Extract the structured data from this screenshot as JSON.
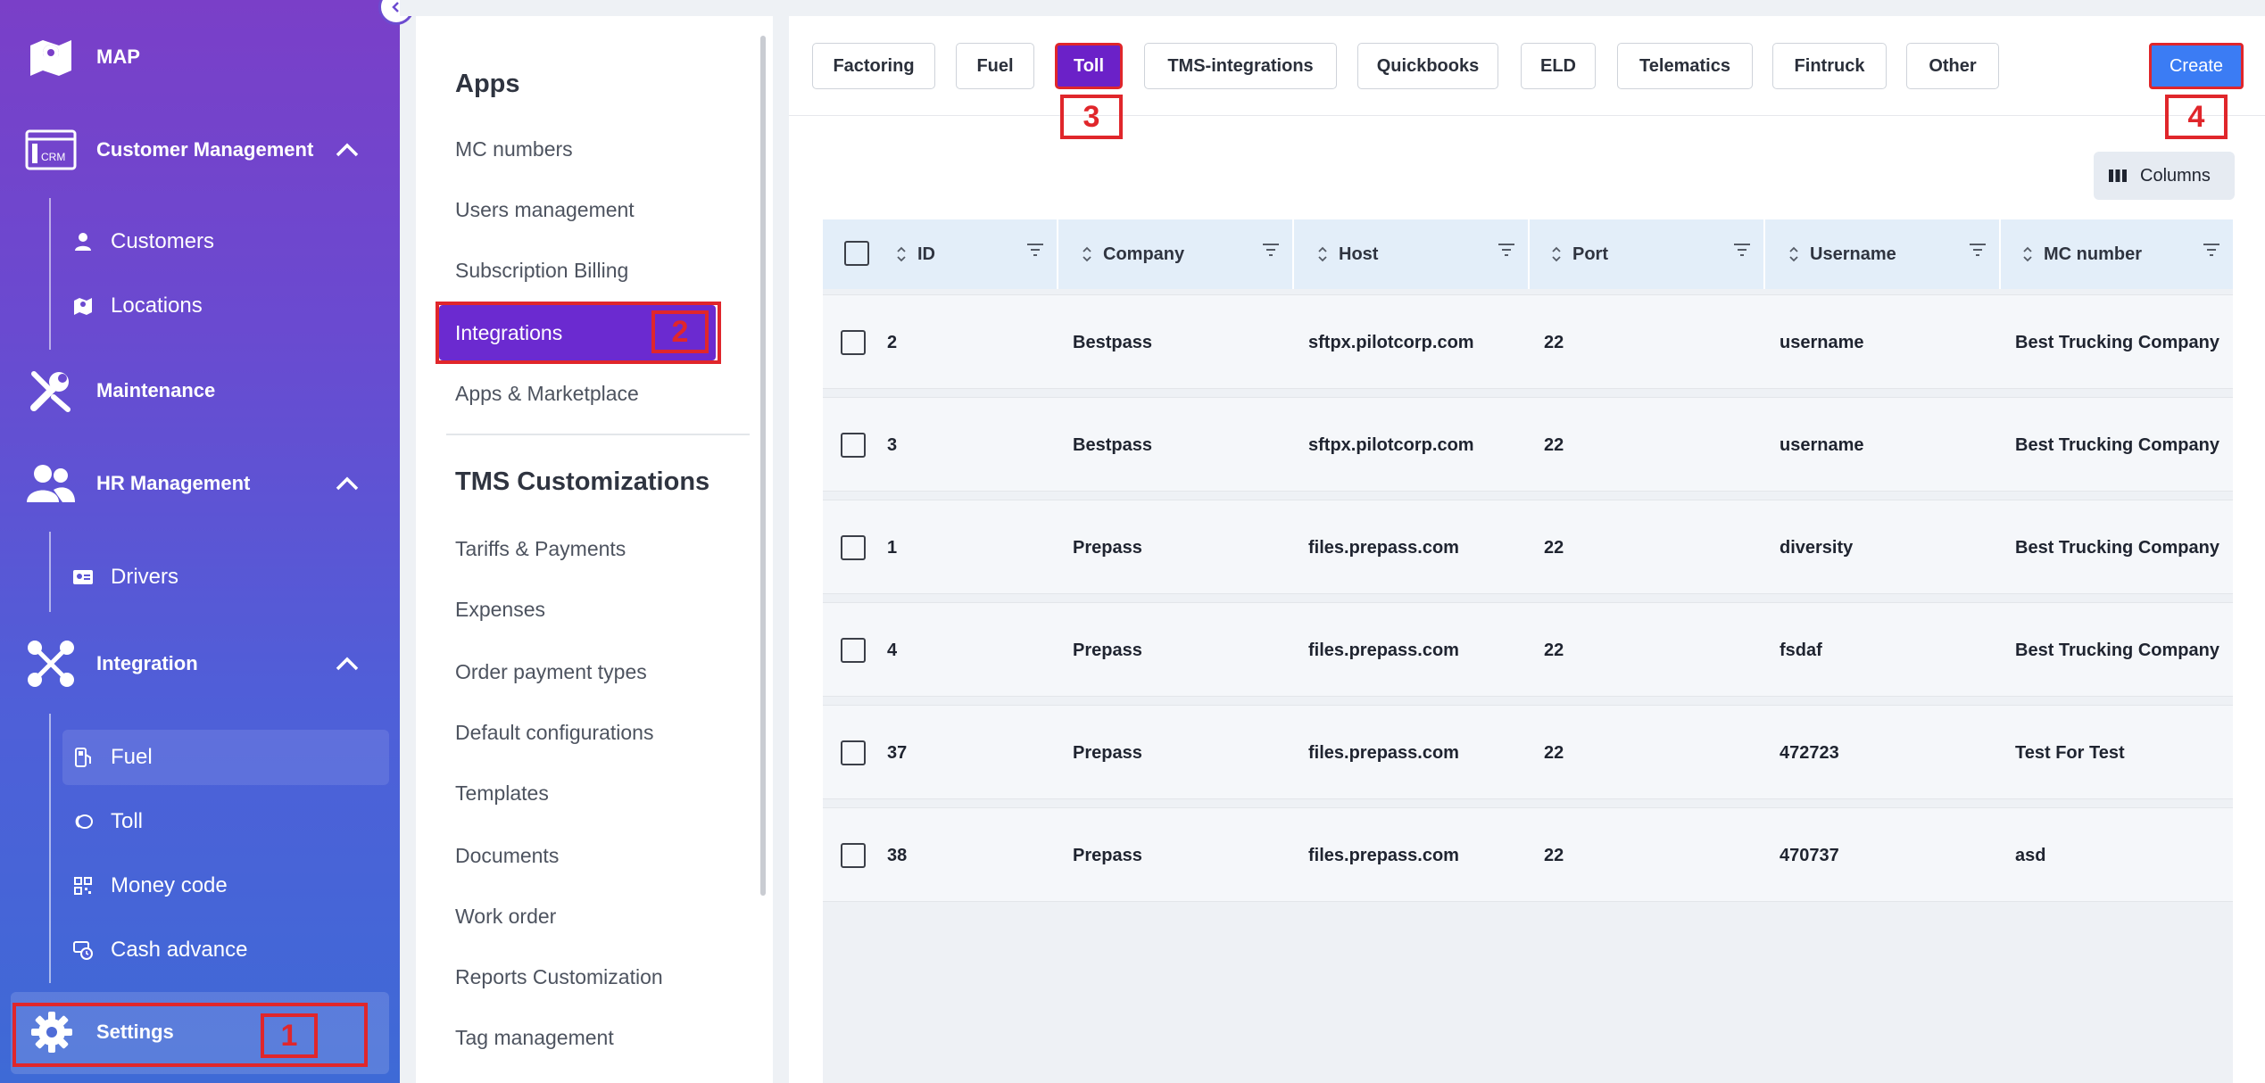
{
  "sidebar": {
    "map": "MAP",
    "customer_management": "Customer Management",
    "customers": "Customers",
    "locations": "Locations",
    "maintenance": "Maintenance",
    "hr_management": "HR Management",
    "drivers": "Drivers",
    "integration": "Integration",
    "fuel": "Fuel",
    "toll": "Toll",
    "money_code": "Money code",
    "cash_advance": "Cash advance",
    "settings": "Settings",
    "crm_badge": "CRM"
  },
  "settings_panel": {
    "apps_title": "Apps",
    "apps_items": [
      "MC numbers",
      "Users management",
      "Subscription Billing",
      "Integrations",
      "Apps & Marketplace"
    ],
    "tms_title": "TMS Customizations",
    "tms_items": [
      "Tariffs & Payments",
      "Expenses",
      "Order payment types",
      "Default configurations",
      "Templates",
      "Documents",
      "Work order",
      "Reports Customization",
      "Tag management"
    ]
  },
  "tabs": [
    "Factoring",
    "Fuel",
    "Toll",
    "TMS-integrations",
    "Quickbooks",
    "ELD",
    "Telematics",
    "Fintruck",
    "Other"
  ],
  "active_tab": "Toll",
  "create_label": "Create",
  "columns_label": "Columns",
  "table": {
    "headers": [
      "ID",
      "Company",
      "Host",
      "Port",
      "Username",
      "MC number"
    ],
    "rows": [
      [
        "2",
        "Bestpass",
        "sftpx.pilotcorp.com",
        "22",
        "username",
        "Best Trucking Company"
      ],
      [
        "3",
        "Bestpass",
        "sftpx.pilotcorp.com",
        "22",
        "username",
        "Best Trucking Company"
      ],
      [
        "1",
        "Prepass",
        "files.prepass.com",
        "22",
        "diversity",
        "Best Trucking Company"
      ],
      [
        "4",
        "Prepass",
        "files.prepass.com",
        "22",
        "fsdaf",
        "Best Trucking Company"
      ],
      [
        "37",
        "Prepass",
        "files.prepass.com",
        "22",
        "472723",
        "Test For Test"
      ],
      [
        "38",
        "Prepass",
        "files.prepass.com",
        "22",
        "470737",
        "asd"
      ]
    ]
  },
  "annotations": [
    "1",
    "2",
    "3",
    "4"
  ],
  "colors": {
    "sidebar_top": "#7a3fc8",
    "sidebar_bottom": "#3e6ad6",
    "accent_purple": "#6b21c8",
    "create_blue": "#3b7cf4",
    "annotation_red": "#e0262b",
    "table_header": "#e3eef9"
  }
}
